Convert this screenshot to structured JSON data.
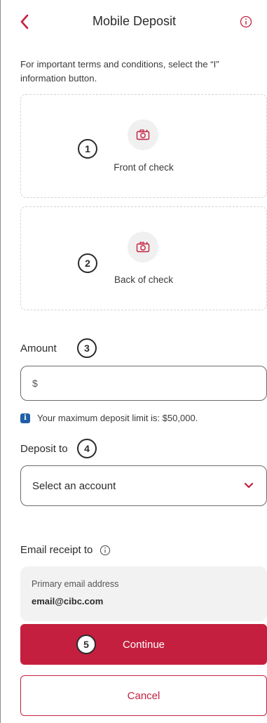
{
  "header": {
    "title": "Mobile Deposit"
  },
  "intro_text": "For important terms and conditions, select the “I” information button.",
  "captures": {
    "front_label": "Front of check",
    "back_label": "Back of check"
  },
  "steps": [
    "1",
    "2",
    "3",
    "4",
    "5"
  ],
  "amount": {
    "label": "Amount",
    "placeholder": "$",
    "limit_note": "Your maximum deposit limit is: $50,000."
  },
  "deposit_to": {
    "label": "Deposit to",
    "selected": "Select an account"
  },
  "email": {
    "label": "Email receipt to",
    "caption": "Primary email address",
    "value": "email@cibc.com"
  },
  "buttons": {
    "continue": "Continue",
    "cancel": "Cancel"
  },
  "icons": {
    "back": "chevron-left-icon",
    "info": "info-circle-icon",
    "camera": "camera-icon",
    "dropdown": "chevron-down-icon",
    "note": "info-square-icon"
  },
  "colors": {
    "brand": "#c41f3e",
    "info_badge": "#1f5fa6"
  }
}
